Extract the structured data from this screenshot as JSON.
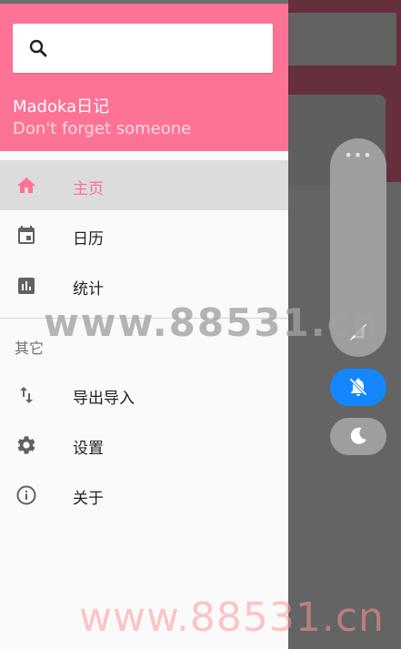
{
  "colors": {
    "accent": "#fd7396",
    "active_bg": "#dcdcdc",
    "mute_button": "#1487ff",
    "icon_gray": "#616161"
  },
  "drawer": {
    "search": {
      "icon": "search-icon",
      "placeholder": ""
    },
    "app_name": "Madoka日记",
    "tagline": "Don't forget someone",
    "nav_items": [
      {
        "label": "主页",
        "icon": "home-icon",
        "active": true
      },
      {
        "label": "日历",
        "icon": "calendar-icon",
        "active": false
      },
      {
        "label": "统计",
        "icon": "stats-icon",
        "active": false
      }
    ],
    "section_other_label": "其它",
    "other_items": [
      {
        "label": "导出导入",
        "icon": "import-export-icon"
      },
      {
        "label": "设置",
        "icon": "gear-icon"
      },
      {
        "label": "关于",
        "icon": "info-icon"
      }
    ]
  },
  "floating_panel": {
    "menu_glyph": "•••",
    "buttons": [
      {
        "icon": "rotate-lock-icon"
      },
      {
        "icon": "bell-off-icon"
      },
      {
        "icon": "moon-icon"
      }
    ]
  },
  "watermarks": {
    "middle": "www.88531.cn",
    "bottom": "www.88531.cn"
  }
}
